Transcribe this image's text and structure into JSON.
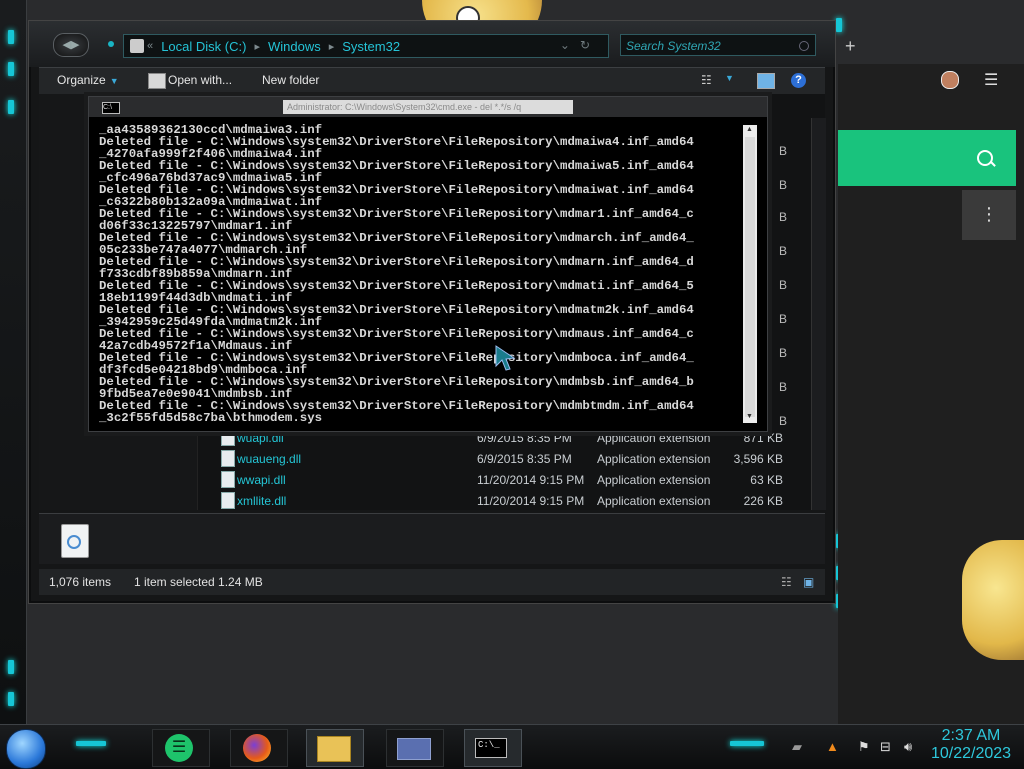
{
  "explorer": {
    "breadcrumbs": [
      "Local Disk (C:)",
      "Windows",
      "System32"
    ],
    "search_placeholder": "Search System32",
    "toolbar": {
      "organize": "Organize",
      "open_with": "Open with...",
      "new_folder": "New folder"
    },
    "files": [
      {
        "name": "wuapi.dll",
        "date": "6/9/2015 8:35 PM",
        "type": "Application extension",
        "size": "871 KB"
      },
      {
        "name": "wuaueng.dll",
        "date": "6/9/2015 8:35 PM",
        "type": "Application extension",
        "size": "3,596 KB"
      },
      {
        "name": "wwapi.dll",
        "date": "11/20/2014 9:15 PM",
        "type": "Application extension",
        "size": "63 KB"
      },
      {
        "name": "xmllite.dll",
        "date": "11/20/2014 9:15 PM",
        "type": "Application extension",
        "size": "226 KB"
      }
    ],
    "status": {
      "items": "1,076 items",
      "selected": "1 item selected  1.24 MB"
    }
  },
  "cmd": {
    "title": "Administrator: C:\\Windows\\System32\\cmd.exe - del *.*/s /q",
    "lines": [
      "_aa43589362130ccd\\mdmaiwa3.inf",
      "Deleted file - C:\\Windows\\system32\\DriverStore\\FileRepository\\mdmaiwa4.inf_amd64",
      "_4270afa999f2f406\\mdmaiwa4.inf",
      "Deleted file - C:\\Windows\\system32\\DriverStore\\FileRepository\\mdmaiwa5.inf_amd64",
      "_cfc496a76bd37ac9\\mdmaiwa5.inf",
      "Deleted file - C:\\Windows\\system32\\DriverStore\\FileRepository\\mdmaiwat.inf_amd64",
      "_c6322b80b132a09a\\mdmaiwat.inf",
      "Deleted file - C:\\Windows\\system32\\DriverStore\\FileRepository\\mdmar1.inf_amd64_c",
      "d06f33c13225797\\mdmar1.inf",
      "Deleted file - C:\\Windows\\system32\\DriverStore\\FileRepository\\mdmarch.inf_amd64_",
      "05c233be747a4077\\mdmarch.inf",
      "Deleted file - C:\\Windows\\system32\\DriverStore\\FileRepository\\mdmarn.inf_amd64_d",
      "f733cdbf89b859a\\mdmarn.inf",
      "Deleted file - C:\\Windows\\system32\\DriverStore\\FileRepository\\mdmati.inf_amd64_5",
      "18eb1199f44d3db\\mdmati.inf",
      "Deleted file - C:\\Windows\\system32\\DriverStore\\FileRepository\\mdmatm2k.inf_amd64",
      "_3942959c25d49fda\\mdmatm2k.inf",
      "Deleted file - C:\\Windows\\system32\\DriverStore\\FileRepository\\mdmaus.inf_amd64_c",
      "42a7cdb49572f1a\\Mdmaus.inf",
      "Deleted file - C:\\Windows\\system32\\DriverStore\\FileRepository\\mdmboca.inf_amd64_",
      "df3fcd5e04218bd9\\mdmboca.inf",
      "Deleted file - C:\\Windows\\system32\\DriverStore\\FileRepository\\mdmbsb.inf_amd64_b",
      "9fbd5ea7e0e9041\\mdmbsb.inf",
      "Deleted file - C:\\Windows\\system32\\DriverStore\\FileRepository\\mdmbtmdm.inf_amd64",
      "_3c2f55fd5d58c7ba\\bthmodem.sys"
    ]
  },
  "taskbar": {
    "time": "2:37 AM",
    "date": "10/22/2023",
    "cmd_icon_label": "C:\\_"
  },
  "colors": {
    "accent_cyan": "#16c6d6",
    "link_cyan": "#25c3d6",
    "green_panel": "#19c37d"
  }
}
